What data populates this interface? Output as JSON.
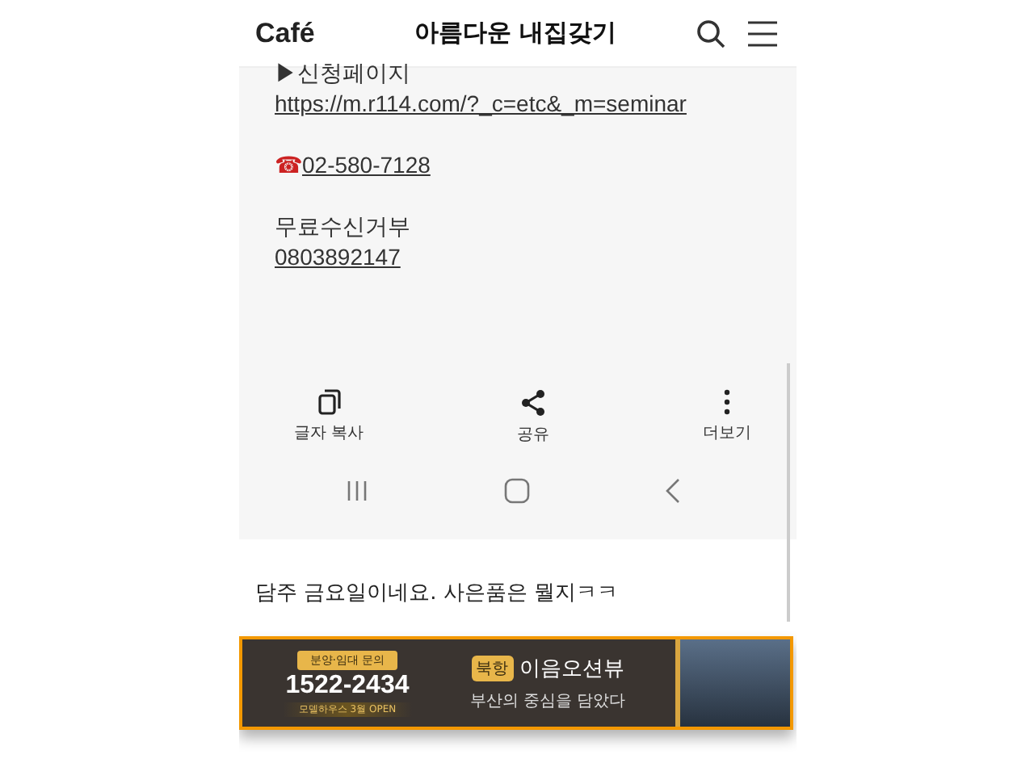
{
  "header": {
    "logo": "Café",
    "title": "아름다운 내집갖기"
  },
  "post": {
    "lines": [
      {
        "kind": "text",
        "text": "▶신청페이지"
      },
      {
        "kind": "link",
        "text": "https://m.r114.com/?_c=etc&_m=seminar"
      },
      {
        "kind": "gap"
      },
      {
        "kind": "phone",
        "icon": "☎",
        "text": "02-580-7128"
      },
      {
        "kind": "gap"
      },
      {
        "kind": "text",
        "text": "무료수신거부"
      },
      {
        "kind": "link",
        "text": "0803892147"
      }
    ]
  },
  "actions": [
    {
      "kind": "copy",
      "label": "글자 복사"
    },
    {
      "kind": "share",
      "label": "공유"
    },
    {
      "kind": "more",
      "label": "더보기"
    }
  ],
  "nav_bar": [
    {
      "kind": "recents"
    },
    {
      "kind": "home"
    },
    {
      "kind": "back"
    }
  ],
  "comment": "담주 금요일이네요. 사은품은 뭘지ㅋㅋ",
  "ad": {
    "inquiry": "분양·임대 문의",
    "phone": "1522-2434",
    "note": "모델하우스 3월 OPEN",
    "tag": "북항",
    "name": "이음오션뷰",
    "slogan": "부산의 중심을 담았다"
  }
}
